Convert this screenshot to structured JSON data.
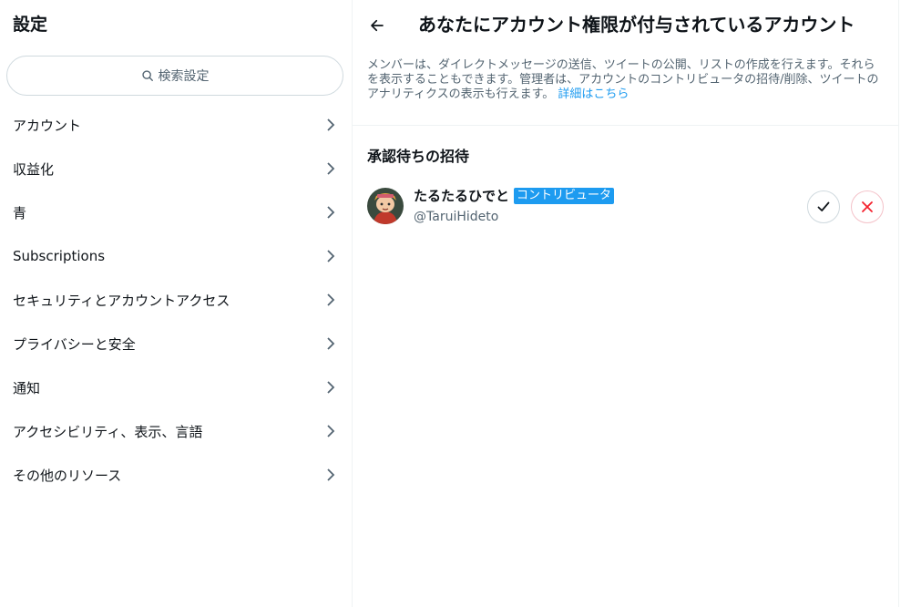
{
  "left": {
    "title": "設定",
    "search_label": "検索設定",
    "menu": [
      {
        "label": "アカウント"
      },
      {
        "label": "収益化"
      },
      {
        "label": "青"
      },
      {
        "label": "Subscriptions"
      },
      {
        "label": "セキュリティとアカウントアクセス"
      },
      {
        "label": "プライバシーと安全"
      },
      {
        "label": "通知"
      },
      {
        "label": "アクセシビリティ、表示、言語"
      },
      {
        "label": "その他のリソース"
      }
    ]
  },
  "right": {
    "title": "あなたにアカウント権限が付与されているアカウント",
    "description_line1": "メンバーは、ダイレクトメッセージの送信、ツイートの公開、リストの作成を行えます。それら",
    "description_line2": "を表示することもできます。管理者は、アカウントのコントリビュータの招待/削除、ツイートの",
    "description_line3": "アナリティクスの表示も行えます。",
    "learn_more": "詳細はこちら",
    "section_title": "承認待ちの招待",
    "invite": {
      "name": "たるたるひでと",
      "role_badge": "コントリビュータ",
      "handle": "@TaruiHideto"
    }
  },
  "colors": {
    "accent": "#1d9bf0",
    "text_primary": "#0f1419",
    "text_secondary": "#536471",
    "border": "#cfd9de",
    "reject": "#f4212e"
  },
  "icons": {
    "search": "search-icon",
    "chevron": "chevron-right-icon",
    "back": "back-arrow-icon",
    "accept": "check-icon",
    "reject": "close-icon"
  }
}
